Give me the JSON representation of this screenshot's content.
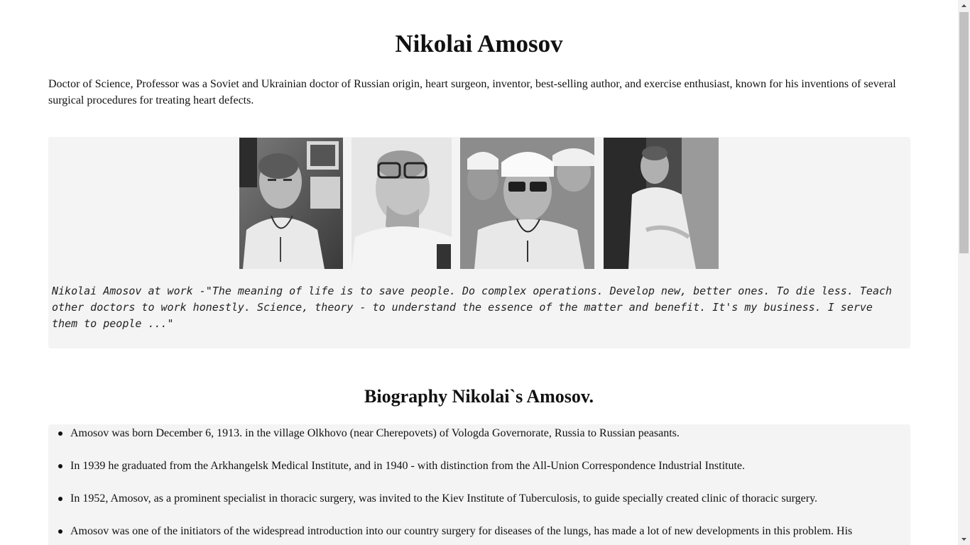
{
  "page": {
    "title": "Nikolai Amosov",
    "intro": "Doctor of Science, Professor was a Soviet and Ukrainian doctor of Russian origin, heart surgeon, inventor, best-selling author, and exercise enthusiast, known for his inventions of several surgical procedures for treating heart defects."
  },
  "gallery": {
    "caption": "Nikolai Amosov at work -\"The meaning of life is to save people. Do complex operations. Develop new, better ones. To die less. Teach other doctors to work honestly. Science, theory - to understand the essence of the matter and benefit. It's my business. I serve them to people ...\""
  },
  "biography": {
    "heading": "Biography Nikolai`s Amosov.",
    "items": [
      "Amosov was born December 6, 1913. in the village Olkhovo (near Cherepovets) of Vologda Governorate, Russia to Russian peasants.",
      "In 1939 he graduated from the Arkhangelsk Medical Institute, and in 1940 - with distinction from the All-Union Correspondence Industrial Institute.",
      "In 1952, Amosov, as a prominent specialist in thoracic surgery, was invited to the Kiev Institute of Tuberculosis, to guide specially created clinic of thoracic surgery.",
      "Amosov was one of the initiators of the widespread introduction into our country surgery for diseases of the lungs, has made a lot of new developments in this problem. His"
    ]
  }
}
